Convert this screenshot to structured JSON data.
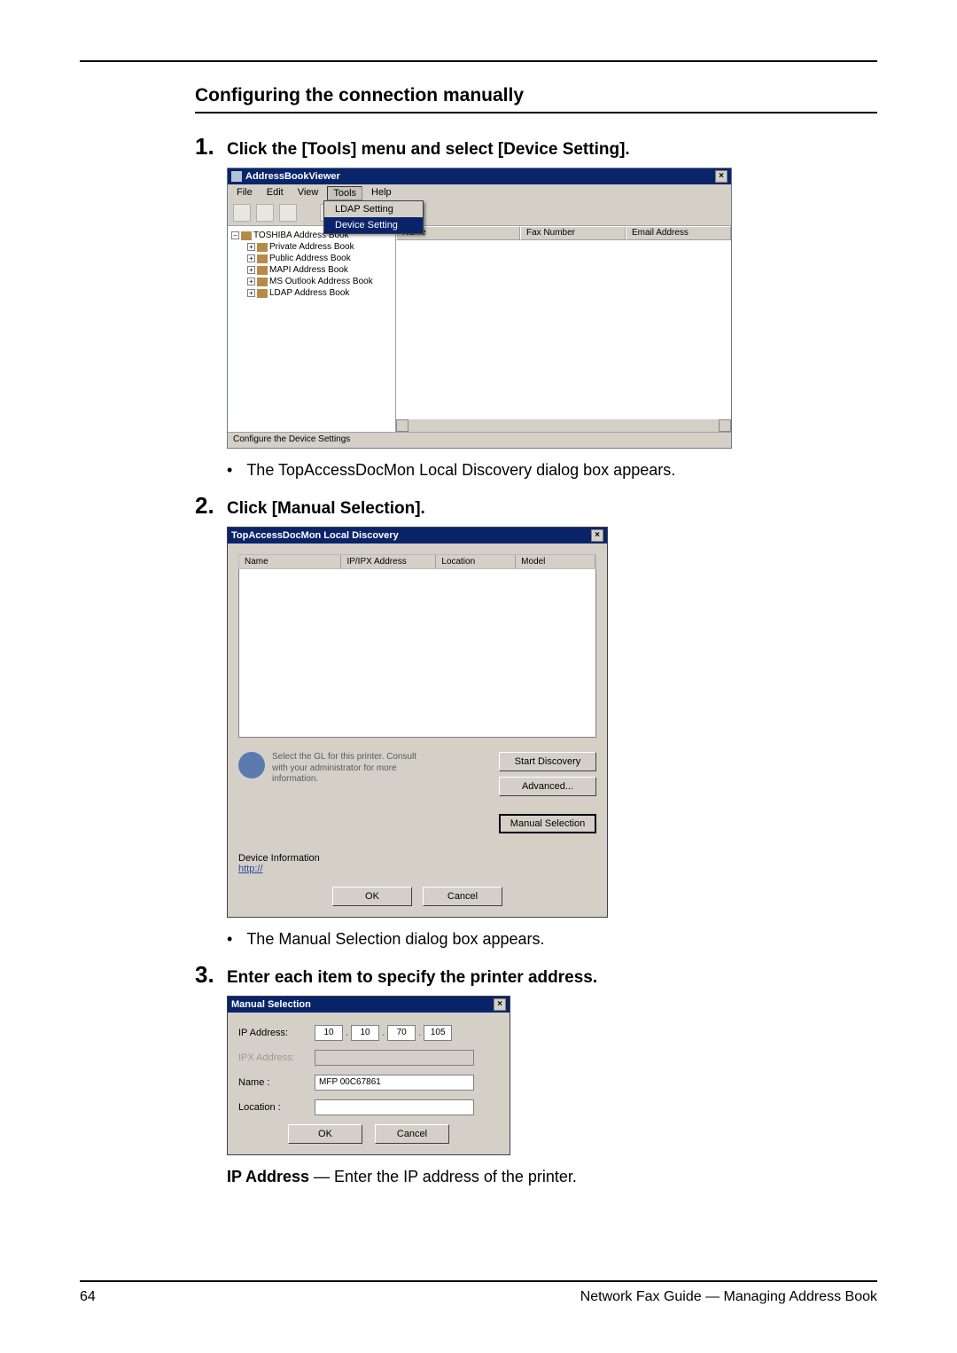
{
  "section_title": "Configuring the connection manually",
  "steps": {
    "s1": {
      "num": "1.",
      "text": "Click the [Tools] menu and select [Device Setting]."
    },
    "s2": {
      "num": "2.",
      "text": "Click [Manual Selection]."
    },
    "s3": {
      "num": "3.",
      "text": "Enter each item to specify the printer address."
    }
  },
  "bullets": {
    "b1": "The TopAccessDocMon Local Discovery dialog box appears.",
    "b2": "The Manual Selection dialog box appears."
  },
  "note": {
    "bold": "IP Address",
    "rest": " — Enter the IP address of the printer."
  },
  "shot1": {
    "title": "AddressBookViewer",
    "menus": {
      "file": "File",
      "edit": "Edit",
      "view": "View",
      "tools": "Tools",
      "help": "Help"
    },
    "dropdown": {
      "ldap": "LDAP Setting",
      "device": "Device Setting"
    },
    "tree": {
      "root": "TOSHIBA Address Book",
      "n1": "Private Address Book",
      "n2": "Public Address Book",
      "n3": "MAPI Address Book",
      "n4": "MS Outlook Address Book",
      "n5": "LDAP Address Book"
    },
    "cols": {
      "name": "Name",
      "fax": "Fax Number",
      "email": "Email Address"
    },
    "status": "Configure the Device Settings"
  },
  "shot2": {
    "title": "TopAccessDocMon Local Discovery",
    "cols": {
      "name": "Name",
      "ip": "IP/IPX Address",
      "loc": "Location",
      "model": "Model"
    },
    "info": "Select the GL for this printer. Consult with your administrator for more information.",
    "buttons": {
      "start": "Start Discovery",
      "adv": "Advanced...",
      "manual": "Manual Selection"
    },
    "di_label": "Device Information",
    "di_value": "http://",
    "ok": "OK",
    "cancel": "Cancel"
  },
  "shot3": {
    "title": "Manual Selection",
    "labels": {
      "ip": "IP Address:",
      "ipx": "IPX Address:",
      "name": "Name :",
      "loc": "Location :"
    },
    "ip": {
      "o1": "10",
      "o2": "10",
      "o3": "70",
      "o4": "105"
    },
    "name_val": "MFP 00C67861",
    "ok": "OK",
    "cancel": "Cancel"
  },
  "footer": {
    "page": "64",
    "right": "Network Fax Guide — Managing Address Book"
  }
}
